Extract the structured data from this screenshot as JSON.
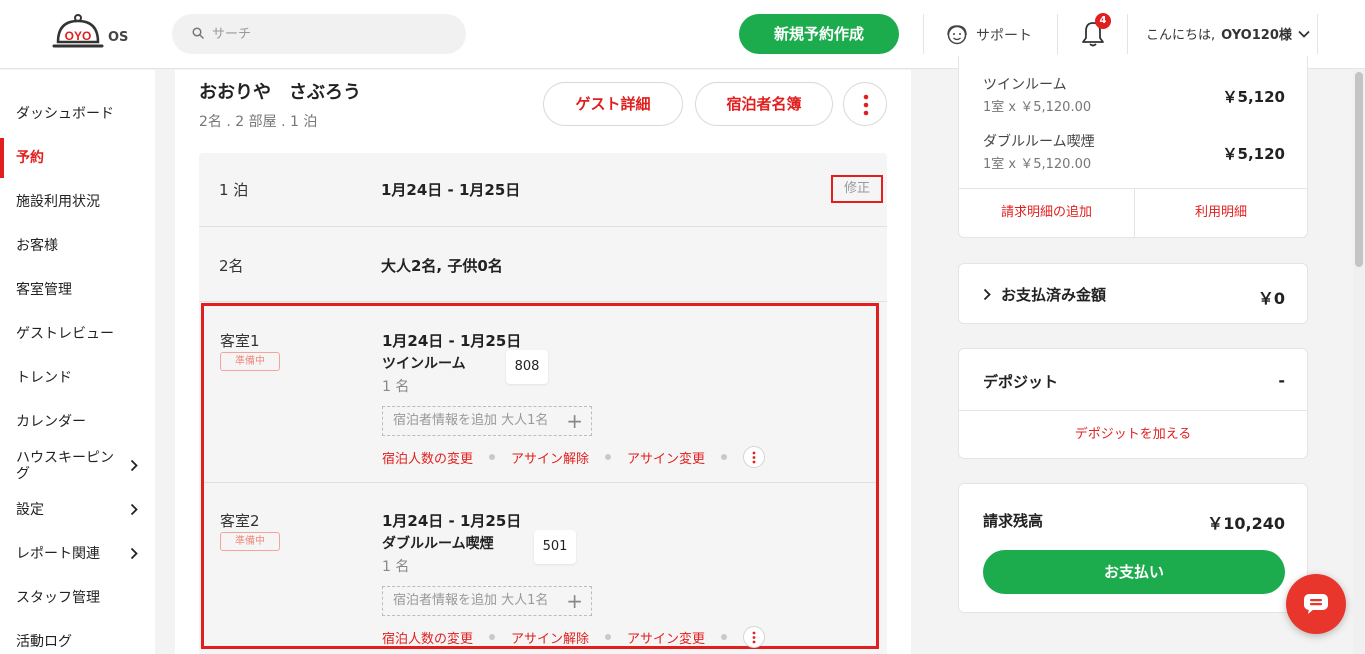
{
  "header": {
    "logo_text": "OYO",
    "logo_suffix": "OS",
    "search_placeholder": "サーチ",
    "new_booking_label": "新規予約作成",
    "support_label": "サポート",
    "notification_count": "4",
    "greeting": "こんにちは,",
    "user_name": "OYO120様"
  },
  "sidebar": {
    "items": [
      {
        "label": "ダッシュボード"
      },
      {
        "label": "予約"
      },
      {
        "label": "施設利用状況"
      },
      {
        "label": "お客様"
      },
      {
        "label": "客室管理"
      },
      {
        "label": "ゲストレビュー"
      },
      {
        "label": "トレンド"
      },
      {
        "label": "カレンダー"
      },
      {
        "label": "ハウスキーピング"
      },
      {
        "label": "設定"
      },
      {
        "label": "レポート関連"
      },
      {
        "label": "スタッフ管理"
      },
      {
        "label": "活動ログ"
      }
    ],
    "active_index": 1
  },
  "booking": {
    "guest_name": "おおりや　さぶろう",
    "summary": "2名 . 2 部屋 . 1 泊",
    "guest_detail_button": "ゲスト詳細",
    "register_button": "宿泊者名簿",
    "nights_label": "1 泊",
    "nights_value": "1月24日 - 1月25日",
    "edit_label": "修正",
    "guests_label": "2名",
    "guests_value": "大人2名, 子供0名",
    "rooms": [
      {
        "label": "客室1",
        "status": "準備中",
        "dates": "1月24日 - 1月25日",
        "room_type": "ツインルーム",
        "room_number": "808",
        "occupancy": "1 名",
        "add_guest": "宿泊者情報を追加 大人1名",
        "action_change_count": "宿泊人数の変更",
        "action_unassign": "アサイン解除",
        "action_reassign": "アサイン変更"
      },
      {
        "label": "客室2",
        "status": "準備中",
        "dates": "1月24日 - 1月25日",
        "room_type": "ダブルルーム喫煙",
        "room_number": "501",
        "occupancy": "1 名",
        "add_guest": "宿泊者情報を追加 大人1名",
        "action_change_count": "宿泊人数の変更",
        "action_unassign": "アサイン解除",
        "action_reassign": "アサイン変更"
      }
    ]
  },
  "billing": {
    "line_items": [
      {
        "name": "ツインルーム",
        "detail": "1室 x ￥5,120.00",
        "amount": "￥5,120"
      },
      {
        "name": "ダブルルーム喫煙",
        "detail": "1室 x ￥5,120.00",
        "amount": "￥5,120"
      }
    ],
    "add_charge_link": "請求明細の追加",
    "usage_link": "利用明細",
    "paid_label": "お支払済み金額",
    "paid_amount": "￥0",
    "deposit_label": "デポジット",
    "deposit_value": "-",
    "add_deposit_link": "デポジットを加える",
    "balance_label": "請求残高",
    "balance_amount": "￥10,240",
    "pay_button": "お支払い"
  },
  "colors": {
    "brand_red": "#e21f1f",
    "brand_green": "#1cab4d",
    "status_pending": "#f08a7e"
  }
}
